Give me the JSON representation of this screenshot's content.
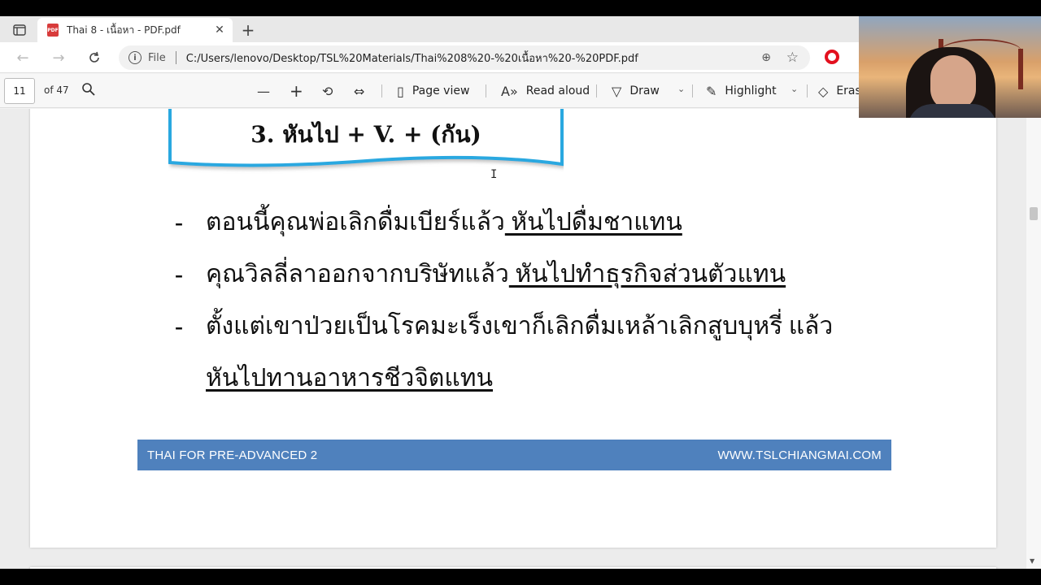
{
  "tab": {
    "title": "Thai 8 - เนื้อหา - PDF.pdf",
    "icon": "pdf-icon",
    "pdf_badge": "PDF"
  },
  "address": {
    "scheme_label": "File",
    "url": "C:/Users/lenovo/Desktop/TSL%20Materials/Thai%208%20-%20เนื้อหา%20-%20PDF.pdf"
  },
  "pdf_toolbar": {
    "page_number": "11",
    "page_total": "of 47",
    "page_view": "Page view",
    "read_aloud": "Read aloud",
    "draw": "Draw",
    "highlight": "Highlight",
    "erase": "Eras"
  },
  "document": {
    "heading": "3. หันไป + V. + (กัน)",
    "bullets": [
      {
        "text": "ตอนนี้คุณพ่อเลิกดื่มเบียร์แล้ว",
        "underlined": " หันไปดื่มชาแทน"
      },
      {
        "text": "คุณวิลลี่ลาออกจากบริษัทแล้ว",
        "underlined": " หันไปทำธุรกิจส่วนตัวแทน"
      },
      {
        "text": "ตั้งแต่เขาป่วยเป็นโรคมะเร็งเขาก็เลิกดื่มเหล้าเลิกสูบบุหรี่ แล้ว",
        "underlined_continuation": "หันไปทานอาหารชีวจิตแทน"
      }
    ],
    "bullet_marker": "-",
    "footer_left": "THAI FOR PRE-ADVANCED 2",
    "footer_right": "WWW.TSLCHIANGMAI.COM"
  },
  "colors": {
    "footer_band": "#4f81bd",
    "title_box_border": "#29a8e0"
  }
}
